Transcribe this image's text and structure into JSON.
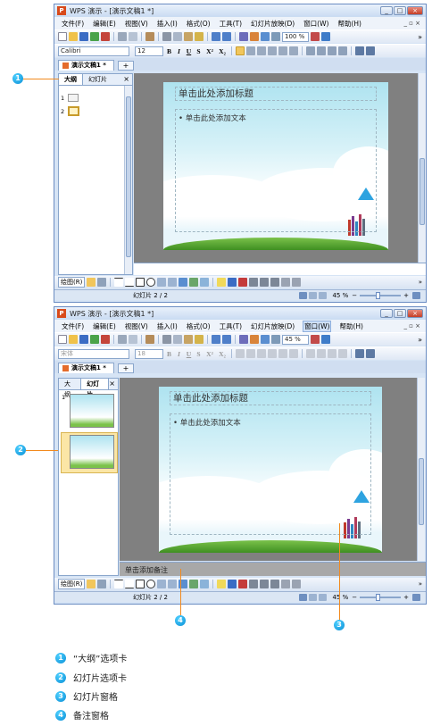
{
  "window": {
    "app_title": "WPS 演示 - [演示文稿1 *]",
    "app_logo_letter": "P",
    "min_label": "_",
    "max_label": "□",
    "close_label": "×"
  },
  "menu": [
    "文件(F)",
    "编辑(E)",
    "视图(V)",
    "插入(I)",
    "格式(O)",
    "工具(T)",
    "幻灯片放映(D)",
    "窗口(W)",
    "帮助(H)"
  ],
  "menu_right": "_ ▫ ×",
  "toolbar": {
    "zoom_value": "100 %",
    "zoom_value_2": "45 %",
    "overflow": "»"
  },
  "format_bar": {
    "font": "Calibri",
    "font_dim": "宋体",
    "size": "12",
    "size_dim": "18",
    "buttons": [
      "B",
      "I",
      "U",
      "S",
      "X²",
      "X₂"
    ]
  },
  "doc_tab": {
    "name": "演示文稿1 *",
    "new_tab": "+"
  },
  "panel": {
    "tab_outline": "大纲",
    "tab_slides": "幻灯片",
    "close": "×",
    "slide_numbers": [
      "1",
      "2"
    ]
  },
  "slide": {
    "title_placeholder": "单击此处添加标题",
    "body_placeholder": "• 单击此处添加文本"
  },
  "notes": {
    "placeholder": "单击添加备注"
  },
  "drawbar": {
    "label": "绘图(R)"
  },
  "status": {
    "slide_counter": "幻灯片 2 / 2",
    "zoom": "45 %",
    "zoom_level_fraction": 0.45,
    "minus": "−",
    "plus": "+"
  },
  "callouts": [
    "1",
    "2",
    "3",
    "4"
  ],
  "legend": [
    {
      "num": "1",
      "text": "“大纲”选项卡"
    },
    {
      "num": "2",
      "text": "幻灯片选项卡"
    },
    {
      "num": "3",
      "text": "幻灯片窗格"
    },
    {
      "num": "4",
      "text": "备注窗格"
    }
  ],
  "colors": {
    "callout": "#0a8fd6",
    "leader": "#f28a1e",
    "work_area": "#808080",
    "chrome": "#d6e4f5"
  }
}
